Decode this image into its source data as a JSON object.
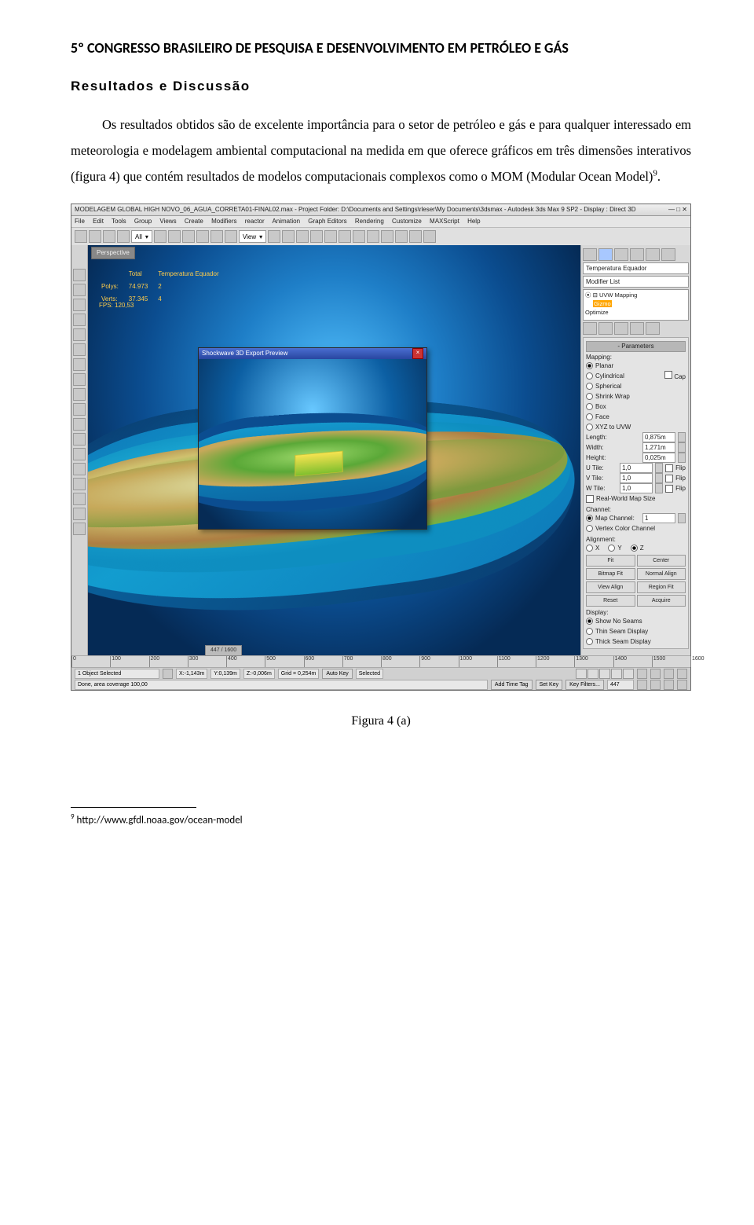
{
  "header": "5º CONGRESSO BRASILEIRO DE PESQUISA E DESENVOLVIMENTO EM PETRÓLEO E GÁS",
  "section_title": "Resultados e Discussão",
  "paragraph": "Os resultados obtidos são de excelente importância para o setor de petróleo e gás e para qualquer interessado em meteorologia e modelagem ambiental computacional na medida em que oferece gráficos em três dimensões interativos (figura 4) que contém resultados de modelos computacionais complexos como o MOM (Modular Ocean Model)",
  "sup_ref": "9",
  "caption": "Figura 4 (a)",
  "footnote_num": "9",
  "footnote_text": " http://www.gfdl.noaa.gov/ocean-model",
  "app": {
    "title_left": "MODELAGEM GLOBAL HIGH NOVO_06_AGUA_CORRETA01-FINAL02.max  -  Project Folder: D:\\Documents and Settings\\rleser\\My Documents\\3dsmax     - Autodesk 3ds Max 9 SP2     - Display : Direct 3D",
    "menus": [
      "File",
      "Edit",
      "Tools",
      "Group",
      "Views",
      "Create",
      "Modifiers",
      "reactor",
      "Animation",
      "Graph Editors",
      "Rendering",
      "Customize",
      "MAXScript",
      "Help"
    ],
    "toolbar": {
      "sel1": "All",
      "sel2": "View"
    },
    "tab": "Perspective",
    "stats": {
      "c0": [
        "",
        "Polys:",
        "Verts:"
      ],
      "c1": [
        "Total",
        "74.973",
        "37.345"
      ],
      "c2": [
        "Temperatura Equador",
        "2",
        "4"
      ]
    },
    "fps": "FPS:   120,53",
    "preview_title": "Shockwave 3D Export Preview",
    "right": {
      "field1": "Temperatura Equador",
      "field2": "Modifier List",
      "tree_top": "⦿ ⊟ UVW Mapping",
      "tree_sel": "Gizmo",
      "tree_opt": "Optimize",
      "params_hdr": "Parameters",
      "mapping_label": "Mapping:",
      "map_opts": [
        "Planar",
        "Cylindrical",
        "Spherical",
        "Shrink Wrap",
        "Box",
        "Face",
        "XYZ to UVW"
      ],
      "cap": "Cap",
      "len_l": "Length:",
      "len_v": "0,875m",
      "wid_l": "Width:",
      "wid_v": "1,271m",
      "hei_l": "Height:",
      "hei_v": "0,025m",
      "utile": "U Tile:",
      "vtile": "V Tile:",
      "wtile": "W Tile:",
      "tile_v": "1,0",
      "flip": "Flip",
      "realworld": "Real-World Map Size",
      "channel_hdr": "Channel:",
      "mapch": "Map Channel:",
      "mapch_v": "1",
      "vcc": "Vertex Color Channel",
      "align_hdr": "Alignment:",
      "axes": [
        "X",
        "Y",
        "Z"
      ],
      "btn_fit": "Fit",
      "btn_center": "Center",
      "btn_bf": "Bitmap Fit",
      "btn_na": "Normal Align",
      "btn_va": "View Align",
      "btn_rf": "Region Fit",
      "btn_reset": "Reset",
      "btn_acq": "Acquire",
      "disp_hdr": "Display:",
      "disp_opts": [
        "Show No Seams",
        "Thin Seam Display",
        "Thick Seam Display"
      ]
    },
    "ruler": {
      "frac": "447 / 1600",
      "ticks": [
        "0",
        "100",
        "200",
        "300",
        "400",
        "500",
        "600",
        "700",
        "800",
        "900",
        "1000",
        "1100",
        "1200",
        "1300",
        "1400",
        "1500",
        "1600"
      ]
    },
    "status": {
      "obj": "1 Object Selected",
      "x": "X:-1,143m",
      "y": "Y:0,139m",
      "z": "Z:-0,006m",
      "grid": "Grid = 0,254m",
      "autokey": "Auto Key",
      "selected": "Selected",
      "done": "Done, area coverage 100,00",
      "addtag": "Add Time Tag",
      "setkey": "Set Key",
      "keyfilt": "Key Filters...",
      "frame": "447"
    }
  }
}
